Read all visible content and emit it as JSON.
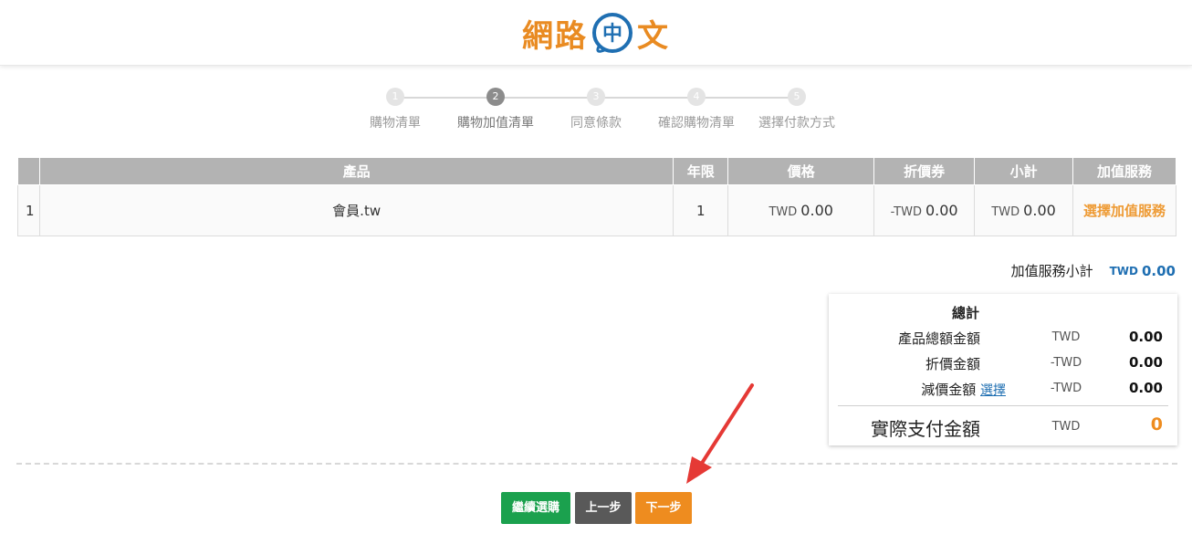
{
  "brand": {
    "logo_left": "網路",
    "logo_right": "文",
    "logo_mark_letter": "中",
    "orange": "#e98b22",
    "blue": "#1f6fb2"
  },
  "steps": [
    {
      "num": "1",
      "label": "購物清單",
      "active": false
    },
    {
      "num": "2",
      "label": "購物加值清單",
      "active": true
    },
    {
      "num": "3",
      "label": "同意條款",
      "active": false
    },
    {
      "num": "4",
      "label": "確認購物清單",
      "active": false
    },
    {
      "num": "5",
      "label": "選擇付款方式",
      "active": false
    }
  ],
  "table": {
    "headers": [
      "",
      "產品",
      "年限",
      "價格",
      "折價券",
      "小計",
      "加值服務"
    ],
    "rows": [
      {
        "index": "1",
        "product": "會員.tw",
        "years": "1",
        "price_currency": "TWD",
        "price_value": "0.00",
        "coupon_currency": "-TWD",
        "coupon_value": "0.00",
        "subtotal_currency": "TWD",
        "subtotal_value": "0.00",
        "addon_link": "選擇加值服務"
      }
    ]
  },
  "addon_subtotal": {
    "label": "加值服務小計",
    "currency": "TWD",
    "value": "0.00"
  },
  "summary": {
    "title": "總計",
    "rows": [
      {
        "label": "產品總額金額",
        "currency": "TWD",
        "value": "0.00"
      },
      {
        "label": "折價金額",
        "currency": "-TWD",
        "value": "0.00"
      },
      {
        "label": "減價金額",
        "link": "選擇",
        "currency": "-TWD",
        "value": "0.00"
      }
    ],
    "final": {
      "label": "實際支付金額",
      "currency": "TWD",
      "value": "0"
    }
  },
  "buttons": {
    "continue": "繼續選購",
    "prev": "上一步",
    "next": "下一步"
  },
  "colors": {
    "header_gray": "#b3b3b3",
    "green": "#1ba14e",
    "dark": "#595959",
    "orange_btn": "#ee8c1f",
    "arrow_red": "#e53935"
  }
}
